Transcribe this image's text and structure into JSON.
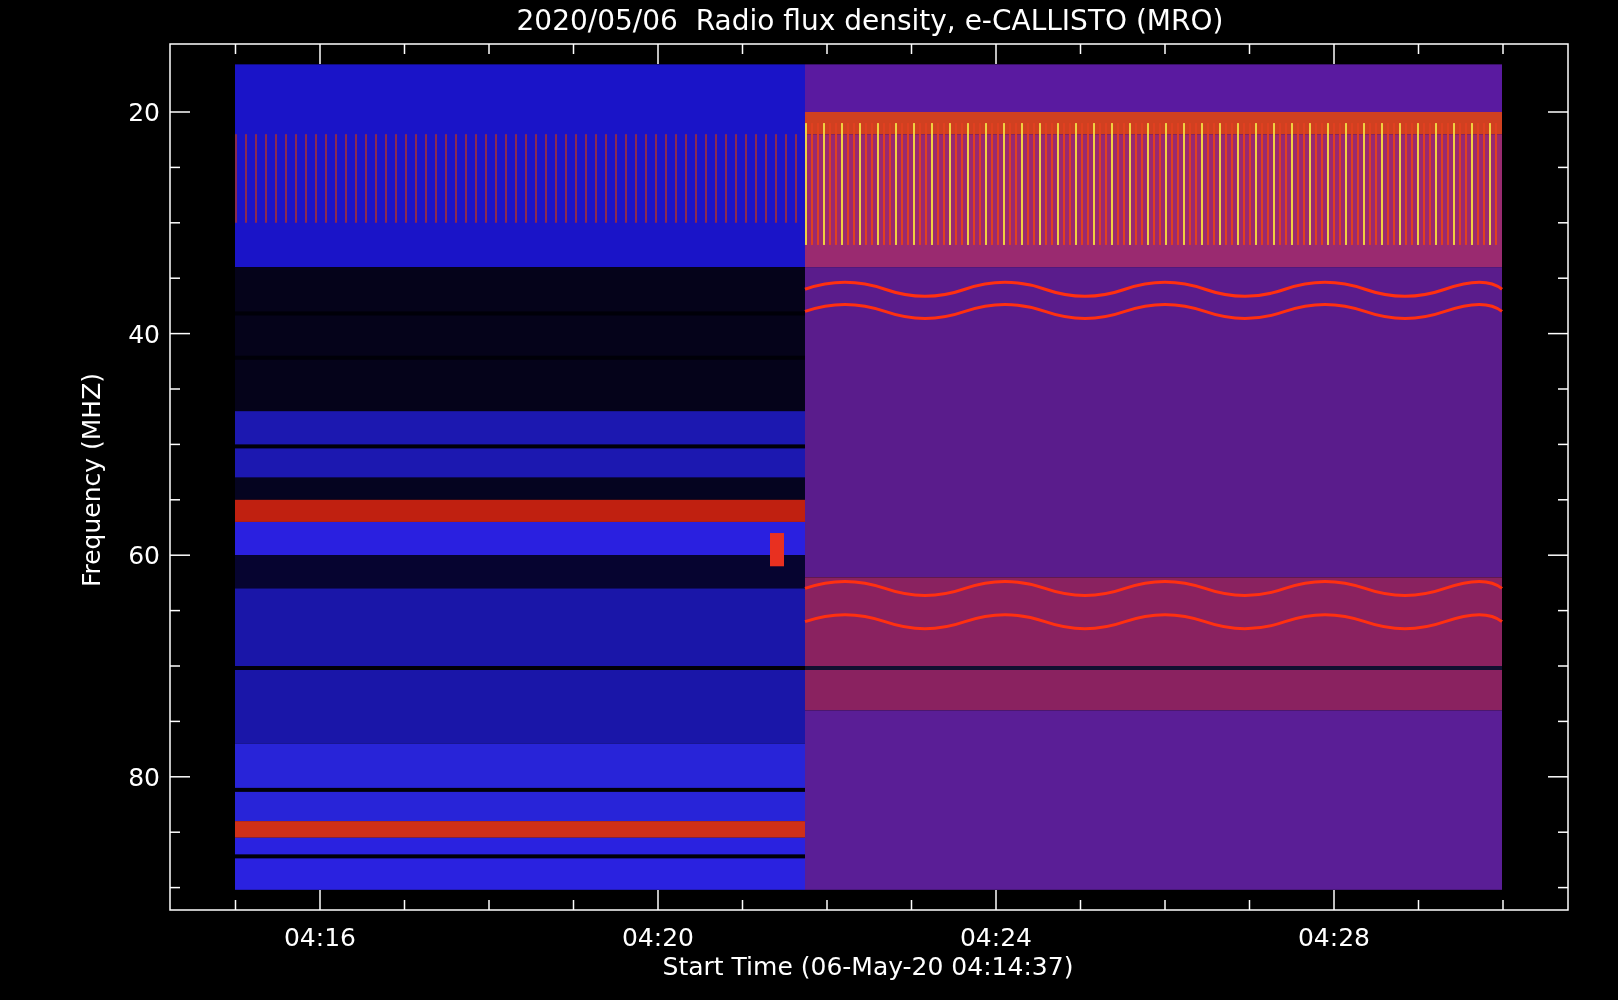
{
  "title": "2020/05/06  Radio flux density, e-CALLISTO (MRO)",
  "axes": {
    "ylabel": "Frequency (MHZ)",
    "xlabel": "Start Time (06-May-20 04:14:37)",
    "yticks": [
      "20",
      "40",
      "60",
      "80"
    ],
    "xticks": [
      "04:16",
      "04:20",
      "04:24",
      "04:28"
    ]
  }
}
